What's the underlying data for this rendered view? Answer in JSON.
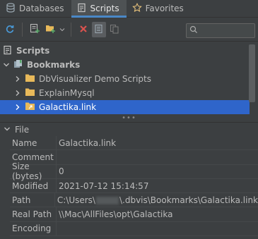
{
  "tabs": [
    {
      "label": "Databases",
      "icon": "database-icon",
      "active": false
    },
    {
      "label": "Scripts",
      "icon": "scripts-icon",
      "active": true
    },
    {
      "label": "Favorites",
      "icon": "star-icon",
      "active": false
    }
  ],
  "toolbar": {
    "buttons": [
      "refresh-icon",
      "new-script-icon",
      "new-folder-icon",
      "dropdown-chevron-icon",
      "delete-icon",
      "show-in-tree-icon",
      "copy-icon"
    ],
    "search_value": ""
  },
  "tree": {
    "root": "Scripts",
    "bookmarks": "Bookmarks",
    "items": [
      {
        "label": "DbVisualizer Demo Scripts",
        "selected": false
      },
      {
        "label": "ExplainMysql",
        "selected": false
      },
      {
        "label": "Galactika.link",
        "selected": true
      }
    ]
  },
  "properties": {
    "section_title": "File",
    "rows": [
      {
        "key": "Name",
        "value": "Galactika.link"
      },
      {
        "key": "Comment",
        "value": ""
      },
      {
        "key": "Size (bytes)",
        "value": "0"
      },
      {
        "key": "Modified",
        "value": "2021-07-12 15:14:57"
      },
      {
        "key": "Path",
        "value_prefix": "C:\\Users\\",
        "value_suffix": "\\.dbvis\\Bookmarks\\Galactika.link"
      },
      {
        "key": "Real Path",
        "value": "\\\\Mac\\AllFiles\\opt\\Galactika"
      },
      {
        "key": "Encoding",
        "value": ""
      }
    ]
  },
  "colors": {
    "background": "#3c3f41",
    "selection": "#2f65ca",
    "active_tab_underline": "#4a88c7",
    "folder": "#e8b95a",
    "delete": "#d9534f"
  }
}
